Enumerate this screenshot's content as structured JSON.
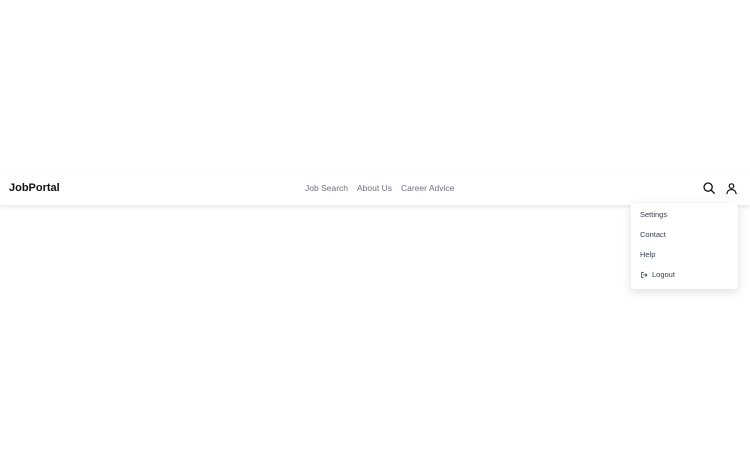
{
  "navbar": {
    "brand": "JobPortal",
    "links": [
      {
        "label": "Job Search"
      },
      {
        "label": "About Us"
      },
      {
        "label": "Career Advice"
      }
    ],
    "search_icon": "search-icon",
    "user_icon": "user-icon"
  },
  "user_menu": {
    "items": [
      {
        "label": "Settings"
      },
      {
        "label": "Contact"
      },
      {
        "label": "Help"
      },
      {
        "label": "Logout",
        "icon": "logout-icon"
      }
    ]
  },
  "colors": {
    "brand_text": "#111111",
    "nav_link": "#6b7280",
    "menu_text": "#374151",
    "background": "#ffffff"
  }
}
